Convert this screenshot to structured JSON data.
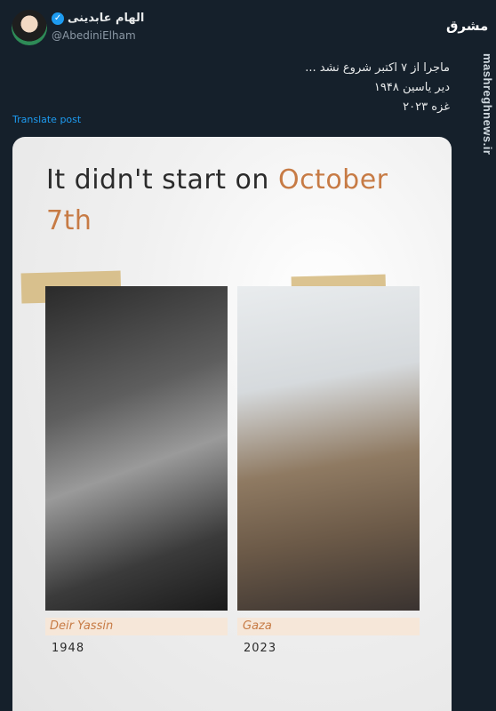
{
  "author": {
    "display_name": "الهام عابدینی",
    "handle": "@AbediniElham",
    "verified": true
  },
  "logo_text": "مشرق",
  "watermark": "mashreghnews.ir",
  "tweet": {
    "lines": [
      "ماجرا از ۷ اکتبر شروع نشد ...",
      "دیر یاسین ۱۹۴۸",
      "غزه ۲۰۲۳"
    ],
    "translate_label": "Translate post"
  },
  "image": {
    "headline_part1": "It didn't start on ",
    "headline_accent1": "October",
    "headline_accent2": "7th",
    "left_photo": {
      "label": "Deir Yassin",
      "year": "1948"
    },
    "right_photo": {
      "label": "Gaza",
      "year": "2023"
    }
  },
  "colors": {
    "background": "#15202b",
    "accent": "#c77b45",
    "link": "#1d9bf0",
    "verified": "#1d9bf0"
  }
}
